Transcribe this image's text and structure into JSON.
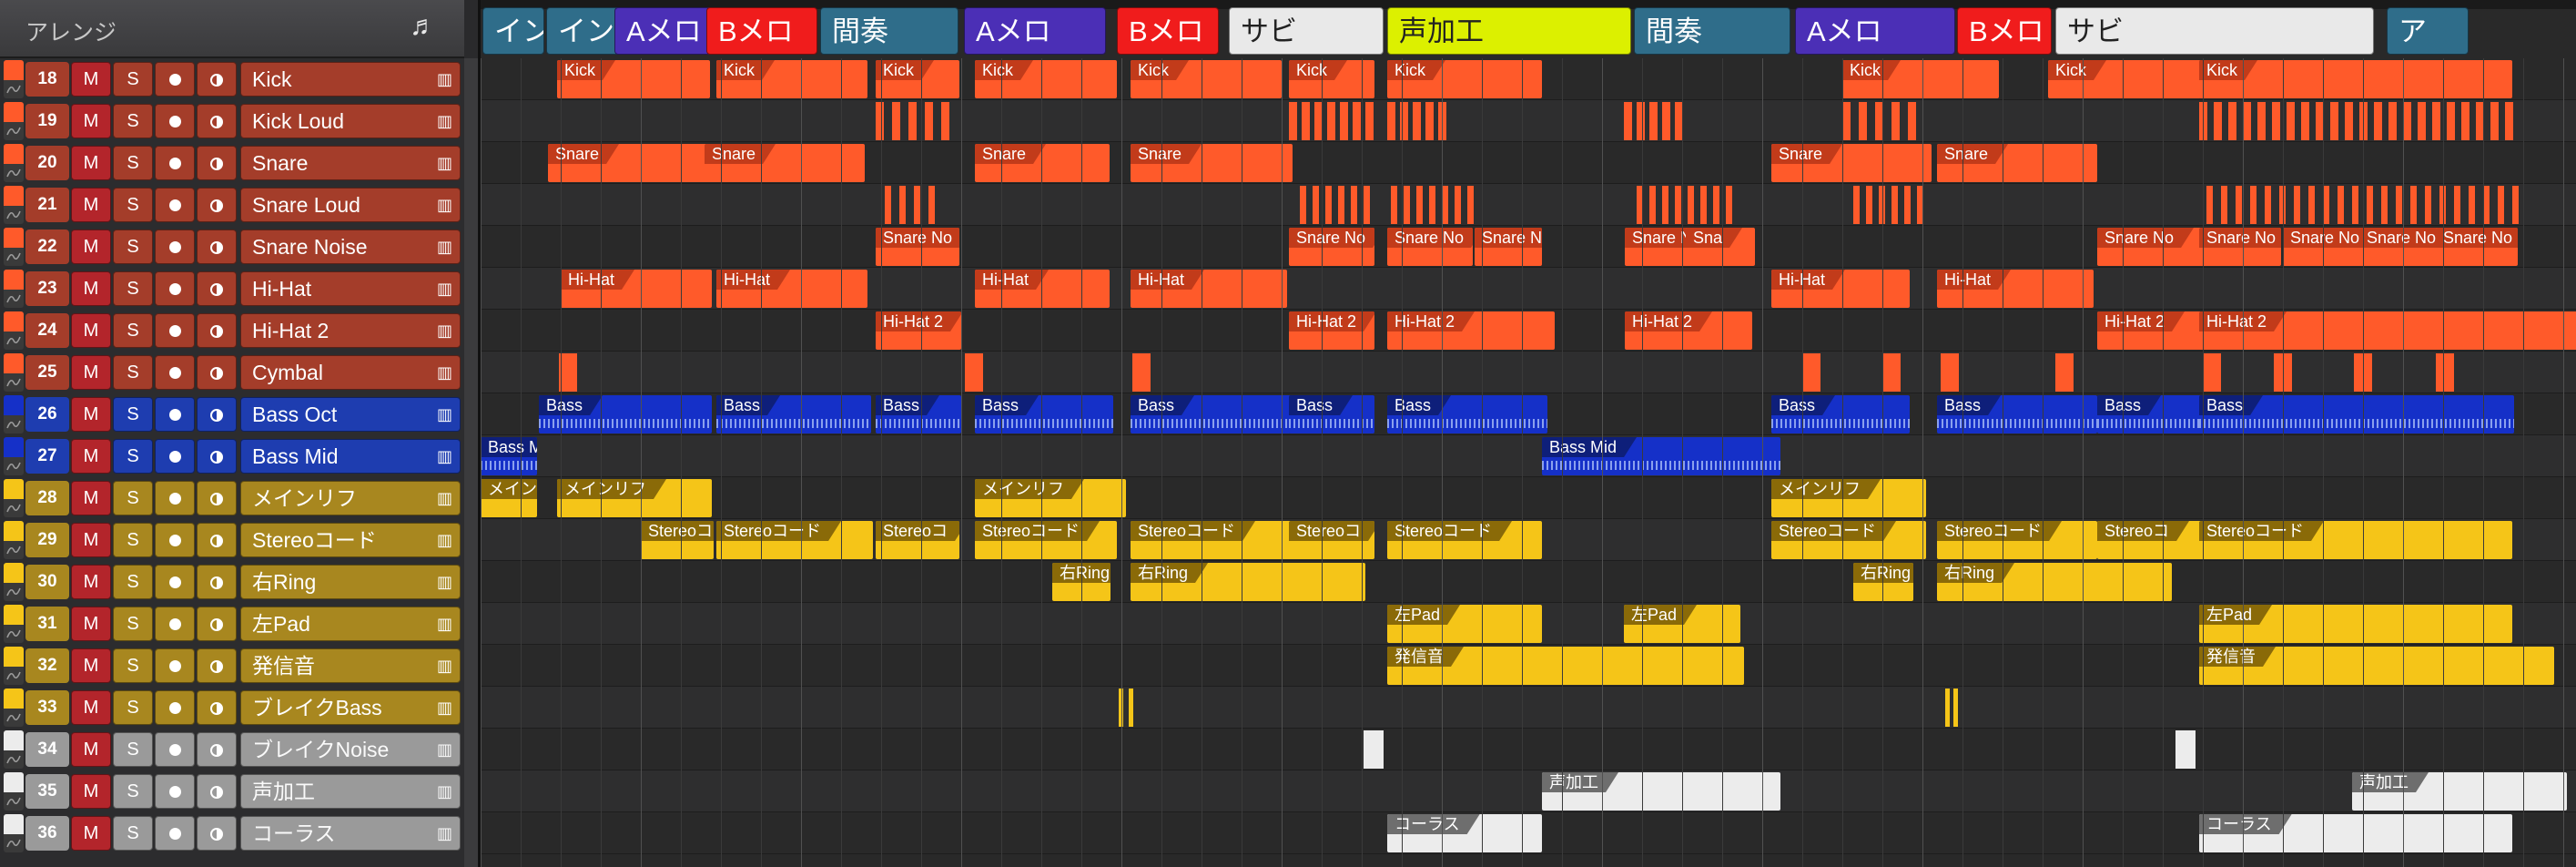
{
  "header": {
    "title": "アレンジ",
    "note_icon": "♬"
  },
  "buttons": {
    "mute": "M",
    "solo": "S"
  },
  "tracks": [
    {
      "num": "18",
      "name": "Kick",
      "group": "drum"
    },
    {
      "num": "19",
      "name": "Kick Loud",
      "group": "drum"
    },
    {
      "num": "20",
      "name": "Snare",
      "group": "drum"
    },
    {
      "num": "21",
      "name": "Snare Loud",
      "group": "drum"
    },
    {
      "num": "22",
      "name": "Snare Noise",
      "group": "drum"
    },
    {
      "num": "23",
      "name": "Hi-Hat",
      "group": "drum"
    },
    {
      "num": "24",
      "name": "Hi-Hat 2",
      "group": "drum"
    },
    {
      "num": "25",
      "name": "Cymbal",
      "group": "drum"
    },
    {
      "num": "26",
      "name": "Bass Oct",
      "group": "bass"
    },
    {
      "num": "27",
      "name": "Bass Mid",
      "group": "bass"
    },
    {
      "num": "28",
      "name": "メインリフ",
      "group": "synth"
    },
    {
      "num": "29",
      "name": "Stereoコード",
      "group": "synth"
    },
    {
      "num": "30",
      "name": "右Ring",
      "group": "synth"
    },
    {
      "num": "31",
      "name": "左Pad",
      "group": "synth"
    },
    {
      "num": "32",
      "name": "発信音",
      "group": "synth"
    },
    {
      "num": "33",
      "name": "ブレイクBass",
      "group": "synth"
    },
    {
      "num": "34",
      "name": "ブレイクNoise",
      "group": "fx"
    },
    {
      "num": "35",
      "name": "声加工",
      "group": "fx"
    },
    {
      "num": "36",
      "name": "コーラス",
      "group": "fx"
    }
  ],
  "markers": [
    {
      "label": "イン",
      "kind": "teal"
    },
    {
      "label": "イントロ",
      "kind": "teal"
    },
    {
      "label": "Aメロ",
      "kind": "purple"
    },
    {
      "label": "Bメロ",
      "kind": "red"
    },
    {
      "label": "間奏",
      "kind": "teal"
    },
    {
      "label": "Aメロ",
      "kind": "purple"
    },
    {
      "label": "Bメロ",
      "kind": "red"
    },
    {
      "label": "サビ",
      "kind": "white"
    },
    {
      "label": "声加工",
      "kind": "lime"
    },
    {
      "label": "間奏",
      "kind": "teal"
    },
    {
      "label": "Aメロ",
      "kind": "purple"
    },
    {
      "label": "Bメロ",
      "kind": "red"
    },
    {
      "label": "サビ",
      "kind": "white"
    },
    {
      "label": "ア",
      "kind": "teal"
    }
  ],
  "colors": {
    "drum": "#a43d2a",
    "drum_clip": "#ff5a2a",
    "drum_label": "#c23b1a",
    "bass": "#1e3db0",
    "bass_clip": "#1530c8",
    "bass_label": "#0e1f7a",
    "synth": "#a8871f",
    "synth_clip": "#f5c518",
    "synth_label": "#8a6a08",
    "fx": "#9a9a9a",
    "fx_clip": "#ececec",
    "fx_label": "#6e6e6e",
    "marker_teal": "#2f6d8a",
    "marker_purple": "#4b2fb6",
    "marker_red": "#f01c1c",
    "marker_white": "#e9e9e9",
    "marker_lime": "#dcf000"
  },
  "clips": [
    {
      "t": 0,
      "label": "Kick"
    },
    {
      "t": 0,
      "label": "Kick"
    },
    {
      "t": 0,
      "label": "Kick"
    },
    {
      "t": 0,
      "label": "Kick"
    },
    {
      "t": 0,
      "label": "Kick"
    },
    {
      "t": 0,
      "label": "Kick"
    },
    {
      "t": 0,
      "label": "Kick"
    },
    {
      "t": 0,
      "label": "Kick"
    },
    {
      "t": 0,
      "label": "Kick"
    },
    {
      "t": 0,
      "label": "Kick"
    },
    {
      "t": 2,
      "label": "Snare"
    },
    {
      "t": 2,
      "label": "Snare"
    },
    {
      "t": 2,
      "label": "Snare"
    },
    {
      "t": 2,
      "label": "Snare"
    },
    {
      "t": 2,
      "label": "Snare"
    },
    {
      "t": 2,
      "label": "Snare"
    },
    {
      "t": 4,
      "label": "Snare No"
    },
    {
      "t": 4,
      "label": "Snare No"
    },
    {
      "t": 4,
      "label": "Snare No"
    },
    {
      "t": 4,
      "label": "Snare No"
    },
    {
      "t": 4,
      "label": "Snare No"
    },
    {
      "t": 4,
      "label": "Sna"
    },
    {
      "t": 4,
      "label": "Snare No"
    },
    {
      "t": 4,
      "label": "Snare No"
    },
    {
      "t": 4,
      "label": "Snare No"
    },
    {
      "t": 4,
      "label": "Snare No"
    },
    {
      "t": 4,
      "label": "Snare No"
    },
    {
      "t": 5,
      "label": "Hi-Hat"
    },
    {
      "t": 5,
      "label": "Hi-Hat"
    },
    {
      "t": 5,
      "label": "Hi-Hat"
    },
    {
      "t": 5,
      "label": "Hi-Hat"
    },
    {
      "t": 5,
      "label": "Hi-Hat"
    },
    {
      "t": 5,
      "label": "Hi-Hat"
    },
    {
      "t": 6,
      "label": "Hi-Hat 2"
    },
    {
      "t": 6,
      "label": "Hi-Hat 2"
    },
    {
      "t": 6,
      "label": "Hi-Hat 2"
    },
    {
      "t": 6,
      "label": "Hi-Hat 2"
    },
    {
      "t": 6,
      "label": "Hi-Hat 2"
    },
    {
      "t": 6,
      "label": "Hi-Hat 2"
    },
    {
      "t": 8,
      "label": "Bass"
    },
    {
      "t": 8,
      "label": "Bass"
    },
    {
      "t": 8,
      "label": "Bass"
    },
    {
      "t": 8,
      "label": "Bass"
    },
    {
      "t": 8,
      "label": "Bass"
    },
    {
      "t": 8,
      "label": "Bass"
    },
    {
      "t": 8,
      "label": "Bass"
    },
    {
      "t": 8,
      "label": "Bass"
    },
    {
      "t": 8,
      "label": "Bass"
    },
    {
      "t": 8,
      "label": "Bass"
    },
    {
      "t": 8,
      "label": "Bass"
    },
    {
      "t": 9,
      "label": "Bass M"
    },
    {
      "t": 9,
      "label": "Bass Mid"
    },
    {
      "t": 10,
      "label": "メイン"
    },
    {
      "t": 10,
      "label": "メインリフ"
    },
    {
      "t": 10,
      "label": "メインリフ"
    },
    {
      "t": 10,
      "label": "メインリフ"
    },
    {
      "t": 11,
      "label": "Stereoコ"
    },
    {
      "t": 11,
      "label": "Stereoコード"
    },
    {
      "t": 11,
      "label": "Stereoコ"
    },
    {
      "t": 11,
      "label": "Stereoコード"
    },
    {
      "t": 11,
      "label": "Stereoコード"
    },
    {
      "t": 11,
      "label": "Stereoコ"
    },
    {
      "t": 11,
      "label": "Stereoコード"
    },
    {
      "t": 11,
      "label": "Stereoコード"
    },
    {
      "t": 11,
      "label": "Stereoコード"
    },
    {
      "t": 11,
      "label": "Stereoコ"
    },
    {
      "t": 11,
      "label": "Stereoコード"
    },
    {
      "t": 12,
      "label": "右Ring"
    },
    {
      "t": 12,
      "label": "右Ring"
    },
    {
      "t": 12,
      "label": "右Ring"
    },
    {
      "t": 12,
      "label": "右Ring"
    },
    {
      "t": 13,
      "label": "左Pad"
    },
    {
      "t": 13,
      "label": "左Pad"
    },
    {
      "t": 13,
      "label": "左Pad"
    },
    {
      "t": 14,
      "label": "発信音"
    },
    {
      "t": 14,
      "label": "発信音"
    },
    {
      "t": 17,
      "label": "声加工"
    },
    {
      "t": 17,
      "label": "声加工"
    },
    {
      "t": 18,
      "label": "コーラス"
    },
    {
      "t": 18,
      "label": "コーラス"
    }
  ]
}
